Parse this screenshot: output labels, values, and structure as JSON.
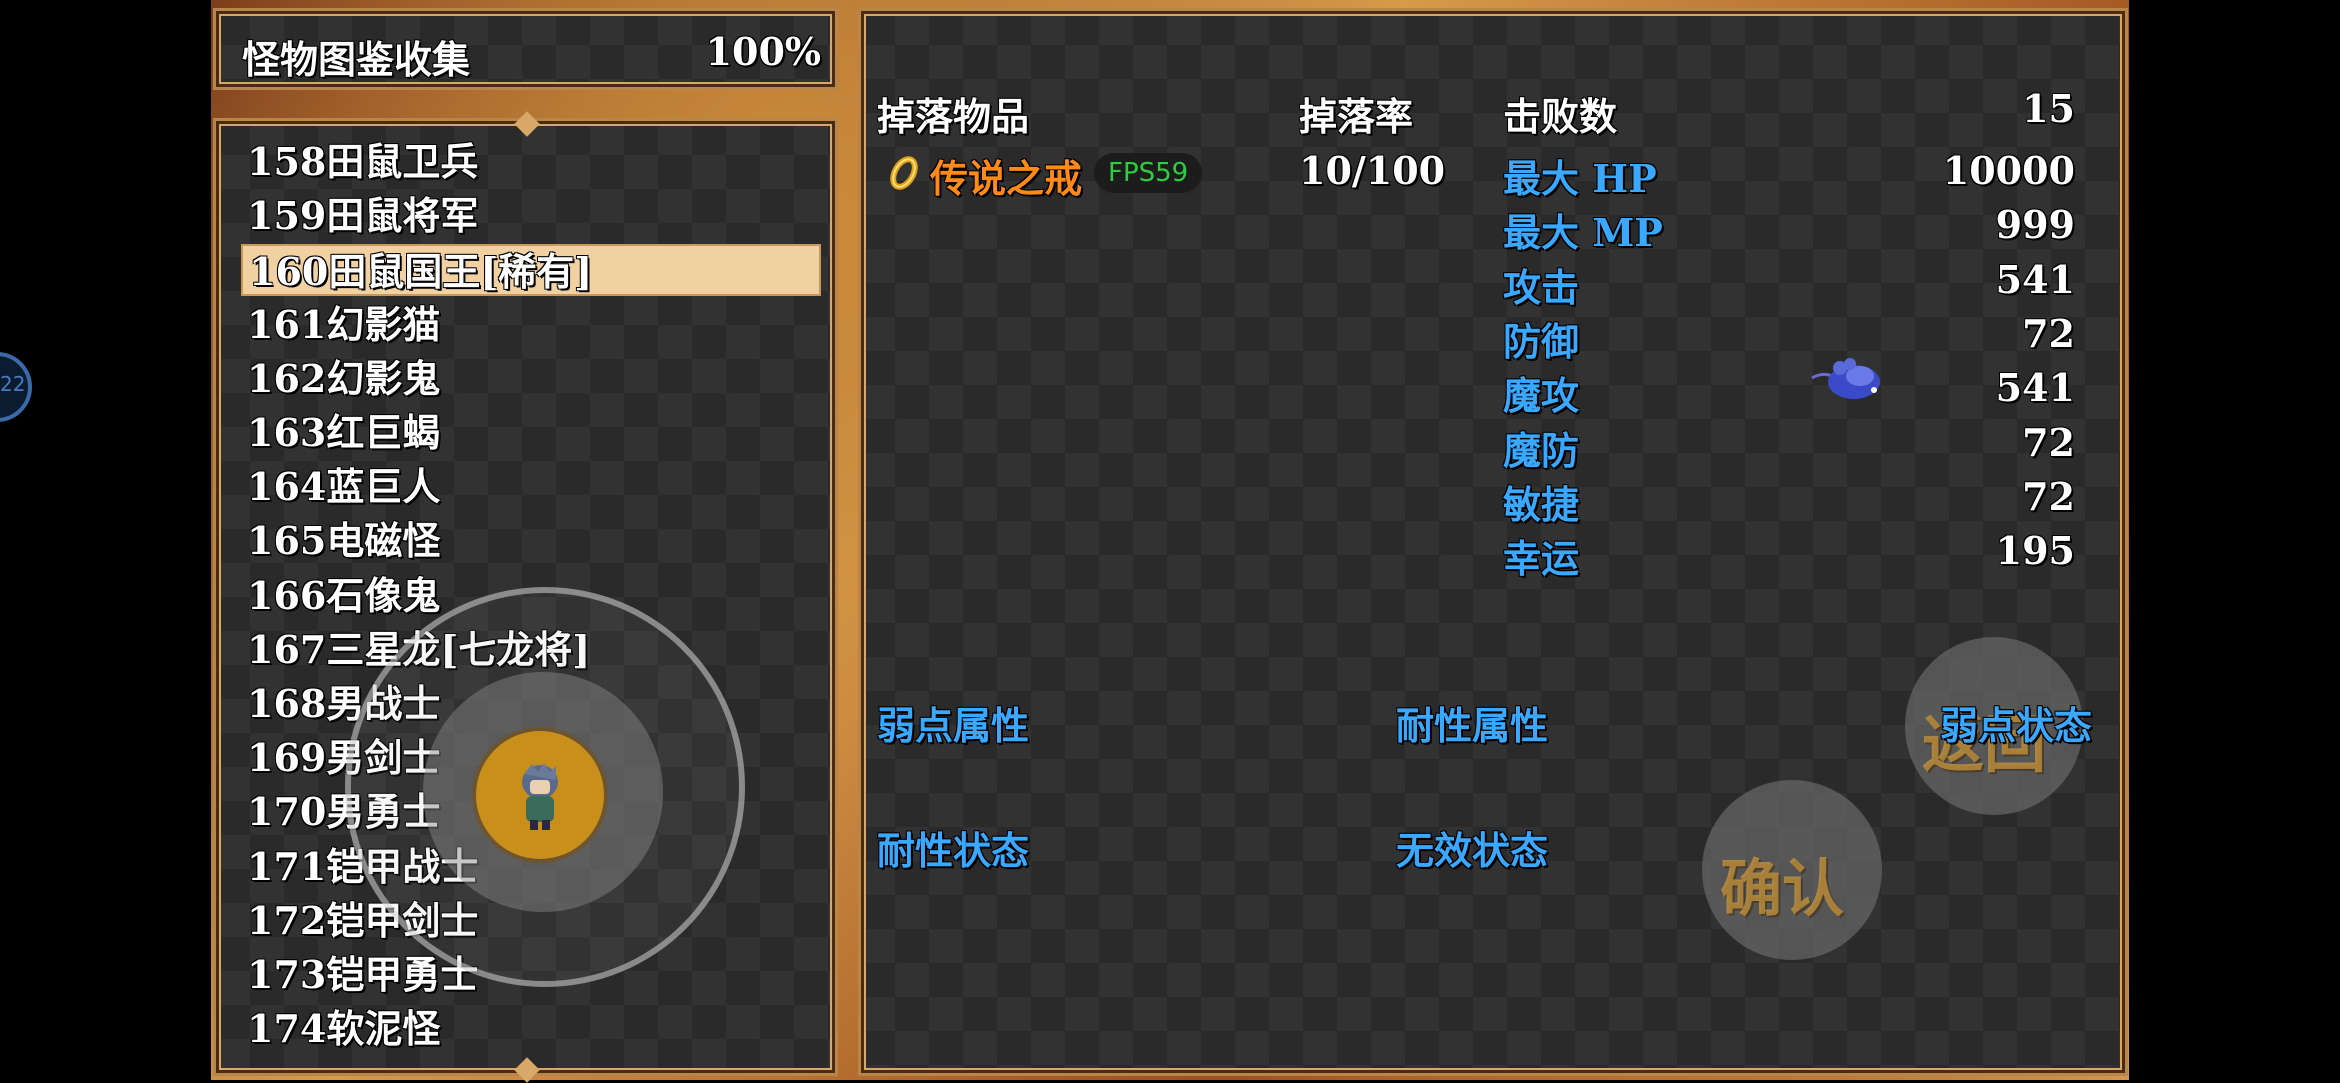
{
  "header": {
    "title": "怪物图鉴收集",
    "percent": "100%"
  },
  "monster_list": [
    {
      "label": "158田鼠卫兵",
      "selected": false
    },
    {
      "label": "159田鼠将军",
      "selected": false
    },
    {
      "label": "160田鼠国王[稀有]",
      "selected": true
    },
    {
      "label": "161幻影猫",
      "selected": false
    },
    {
      "label": "162幻影鬼",
      "selected": false
    },
    {
      "label": "163红巨蝎",
      "selected": false
    },
    {
      "label": "164蓝巨人",
      "selected": false
    },
    {
      "label": "165电磁怪",
      "selected": false
    },
    {
      "label": "166石像鬼",
      "selected": false
    },
    {
      "label": "167三星龙[七龙将]",
      "selected": false
    },
    {
      "label": "168男战士",
      "selected": false
    },
    {
      "label": "169男剑士",
      "selected": false
    },
    {
      "label": "170男勇士",
      "selected": false
    },
    {
      "label": "171铠甲战士",
      "selected": false
    },
    {
      "label": "172铠甲剑士",
      "selected": false
    },
    {
      "label": "173铠甲勇士",
      "selected": false
    },
    {
      "label": "174软泥怪",
      "selected": false
    }
  ],
  "detail": {
    "drop_items_label": "掉落物品",
    "drop_rate_label": "掉落率",
    "defeats_label": "击败数",
    "defeats_value": "15",
    "drop_item_name": "传说之戒",
    "drop_item_icon": "ring-icon",
    "drop_rate_value": "10/100",
    "stats": [
      {
        "label": "最大 HP",
        "value": "10000"
      },
      {
        "label": "最大 MP",
        "value": "999"
      },
      {
        "label": "攻击",
        "value": "541"
      },
      {
        "label": "防御",
        "value": "72"
      },
      {
        "label": "魔攻",
        "value": "541"
      },
      {
        "label": "魔防",
        "value": "72"
      },
      {
        "label": "敏捷",
        "value": "72"
      },
      {
        "label": "幸运",
        "value": "195"
      }
    ],
    "weak_element_label": "弱点属性",
    "resist_element_label": "耐性属性",
    "weak_state_label": "弱点状态",
    "resist_state_label": "耐性状态",
    "immune_state_label": "无效状态"
  },
  "overlay": {
    "fps": "FPS59",
    "confirm_label": "确认",
    "back_label": "返回",
    "side_badge": "22"
  },
  "colors": {
    "stat_label": "#3aa8ff",
    "item_name": "#ff8a1a",
    "fps": "#2ecc40",
    "selection": "#f1d1a1"
  }
}
